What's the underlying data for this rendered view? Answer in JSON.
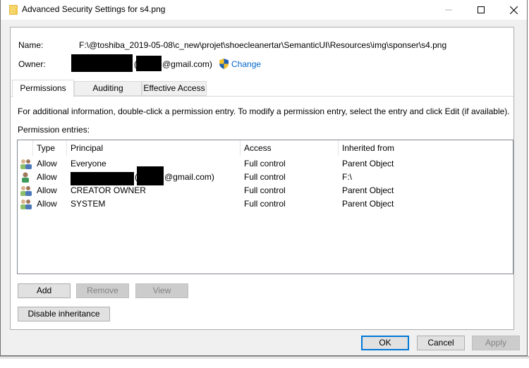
{
  "window": {
    "title": "Advanced Security Settings for s4.png",
    "icon": "folder-icon",
    "controls": {
      "minimize": "minimize",
      "maximize": "maximize",
      "close": "close"
    }
  },
  "details": {
    "name_label": "Name:",
    "name_value": "F:\\@toshiba_2019-05-08\\c_new\\projet\\shoecleanertar\\SemanticUI\\Resources\\img\\sponser\\s4.png",
    "owner_label": "Owner:",
    "owner_value_suffix": "@gmail.com)",
    "owner_value_paren": "(",
    "change_link": "Change",
    "change_icon": "uac-shield-icon"
  },
  "tabs": [
    {
      "label": "Permissions",
      "active": true
    },
    {
      "label": "Auditing",
      "active": false
    },
    {
      "label": "Effective Access",
      "active": false
    }
  ],
  "permissions": {
    "info_text": "For additional information, double-click a permission entry. To modify a permission entry, select the entry and click Edit (if available).",
    "entries_label": "Permission entries:",
    "columns": [
      "Type",
      "Principal",
      "Access",
      "Inherited from"
    ],
    "rows": [
      {
        "icon": "group-icon",
        "type": "Allow",
        "principal": "Everyone",
        "access": "Full control",
        "inherited_from": "Parent Object"
      },
      {
        "icon": "user-icon",
        "type": "Allow",
        "principal_paren": "(",
        "principal": "@gmail.com)",
        "access": "Full control",
        "inherited_from": "F:\\"
      },
      {
        "icon": "group-icon",
        "type": "Allow",
        "principal": "CREATOR OWNER",
        "access": "Full control",
        "inherited_from": "Parent Object"
      },
      {
        "icon": "group-icon",
        "type": "Allow",
        "principal": "SYSTEM",
        "access": "Full control",
        "inherited_from": "Parent Object"
      }
    ]
  },
  "buttons": {
    "add": "Add",
    "remove": "Remove",
    "view": "View",
    "disable_inheritance": "Disable inheritance",
    "ok": "OK",
    "cancel": "Cancel",
    "apply": "Apply"
  }
}
